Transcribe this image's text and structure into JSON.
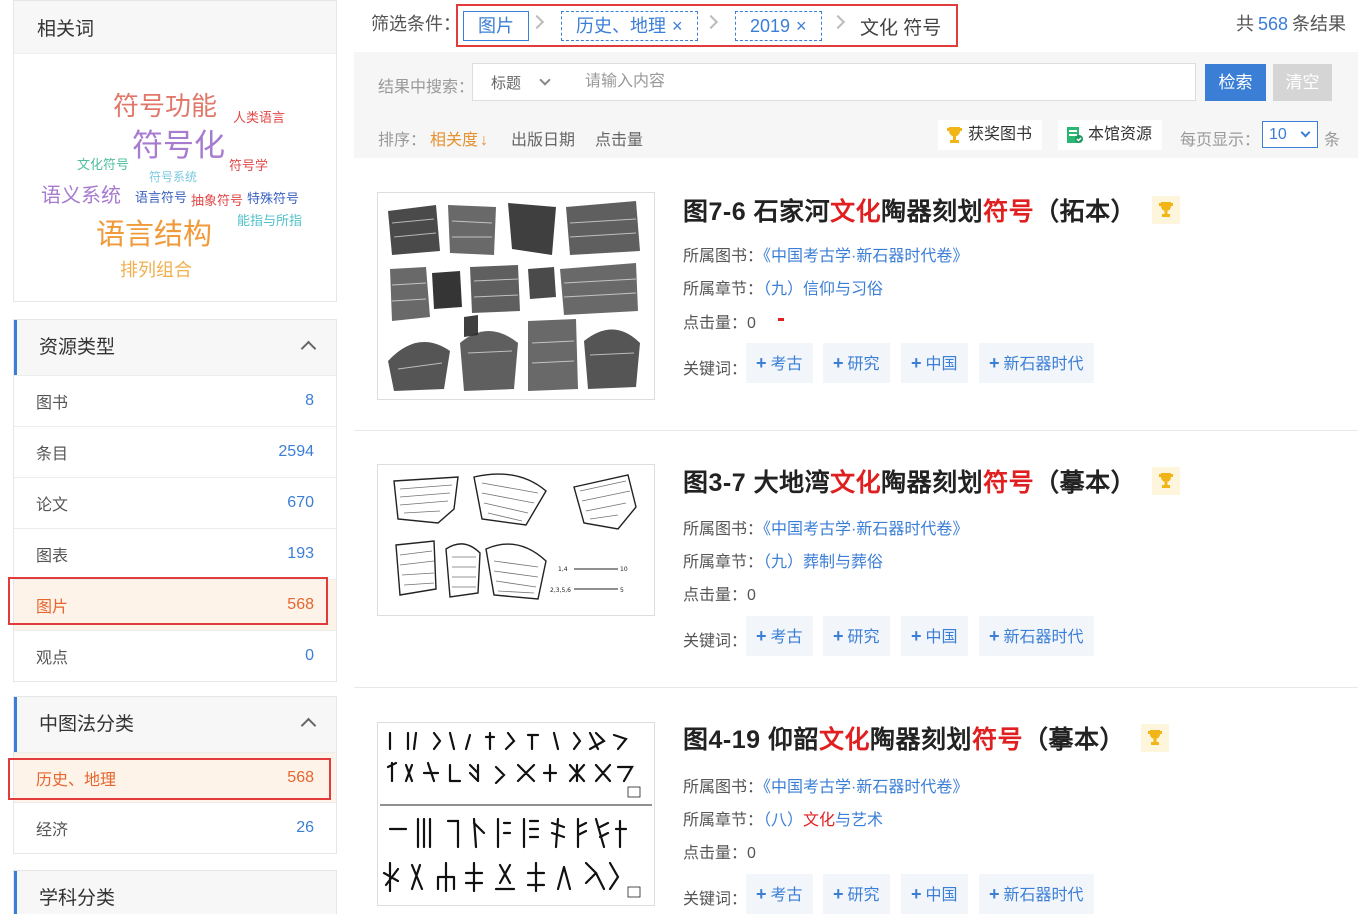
{
  "sidebar": {
    "related_title": "相关词",
    "cloud": [
      {
        "text": "符号功能",
        "color": "#e0786a"
      },
      {
        "text": "人类语言",
        "color": "#e04848"
      },
      {
        "text": "符号化",
        "color": "#a77bd0"
      },
      {
        "text": "文化符号",
        "color": "#4fbfa0"
      },
      {
        "text": "符号系统",
        "color": "#7ac9e0"
      },
      {
        "text": "符号学",
        "color": "#e04848"
      },
      {
        "text": "语义系统",
        "color": "#a77bd0"
      },
      {
        "text": "语言符号",
        "color": "#3b62c0"
      },
      {
        "text": "抽象符号",
        "color": "#e04848"
      },
      {
        "text": "特殊符号",
        "color": "#3b62c0"
      },
      {
        "text": "能指与所指",
        "color": "#4fbfc9"
      },
      {
        "text": "语言结构",
        "color": "#f09a3a"
      },
      {
        "text": "排列组合",
        "color": "#f0b050"
      }
    ],
    "resource_type": {
      "title": "资源类型",
      "items": [
        {
          "label": "图书",
          "count": "8"
        },
        {
          "label": "条目",
          "count": "2594"
        },
        {
          "label": "论文",
          "count": "670"
        },
        {
          "label": "图表",
          "count": "193"
        },
        {
          "label": "图片",
          "count": "568"
        },
        {
          "label": "观点",
          "count": "0"
        }
      ]
    },
    "clc": {
      "title": "中图法分类",
      "items": [
        {
          "label": "历史、地理",
          "count": "568"
        },
        {
          "label": "经济",
          "count": "26"
        }
      ]
    },
    "subject": {
      "title": "学科分类"
    }
  },
  "filter": {
    "label": "筛选条件：",
    "chip1": "图片",
    "chip2": "历史、地理",
    "chip3": "2019",
    "remove_glyph": "×",
    "keyword": "文化 符号",
    "total_prefix": "共",
    "total_count": "568",
    "total_suffix": "条结果"
  },
  "search": {
    "label": "结果中搜索：",
    "field_select": "标题",
    "placeholder": "请输入内容",
    "search_btn": "检索",
    "clear_btn": "清空"
  },
  "sort": {
    "label": "排序：",
    "relevance": "相关度",
    "relevance_arrow": "↓",
    "pub_date": "出版日期",
    "clicks": "点击量",
    "award_books": "获奖图书",
    "library_resources": "本馆资源",
    "per_page_label": "每页显示：",
    "per_page_value": "10",
    "per_page_unit": "条"
  },
  "results": [
    {
      "title_pre": "图7-6 石家河",
      "title_hl1": "文化",
      "title_mid": "陶器刻划",
      "title_hl2": "符号",
      "title_post": "（拓本）",
      "book_label": "所属图书：",
      "book": "《中国考古学·新石器时代卷》",
      "chapter_label": "所属章节：",
      "chapter_pre": "（九）信仰与习俗",
      "chapter_hl": "",
      "chapter_post": "",
      "clicks_label": "点击量：",
      "clicks": "0",
      "kw_label": "关键词：",
      "keywords": [
        "考古",
        "研究",
        "中国",
        "新石器时代"
      ]
    },
    {
      "title_pre": "图3-7 大地湾",
      "title_hl1": "文化",
      "title_mid": "陶器刻划",
      "title_hl2": "符号",
      "title_post": "（摹本）",
      "book_label": "所属图书：",
      "book": "《中国考古学·新石器时代卷》",
      "chapter_label": "所属章节：",
      "chapter_pre": "（九）葬制与葬俗",
      "chapter_hl": "",
      "chapter_post": "",
      "clicks_label": "点击量：",
      "clicks": "0",
      "kw_label": "关键词：",
      "keywords": [
        "考古",
        "研究",
        "中国",
        "新石器时代"
      ]
    },
    {
      "title_pre": "图4-19 仰韶",
      "title_hl1": "文化",
      "title_mid": "陶器刻划",
      "title_hl2": "符号",
      "title_post": "（摹本）",
      "book_label": "所属图书：",
      "book": "《中国考古学·新石器时代卷》",
      "chapter_label": "所属章节：",
      "chapter_pre": "（八）",
      "chapter_hl": "文化",
      "chapter_post": "与艺术",
      "clicks_label": "点击量：",
      "clicks": "0",
      "kw_label": "关键词：",
      "keywords": [
        "考古",
        "研究",
        "中国",
        "新石器时代"
      ]
    }
  ],
  "colors": {
    "accent": "#3b7ed6",
    "highlight_red": "#e02020",
    "selected_orange": "#e5662f",
    "selected_bg": "#fdf3e8",
    "annotation_red": "#e23b3b"
  }
}
